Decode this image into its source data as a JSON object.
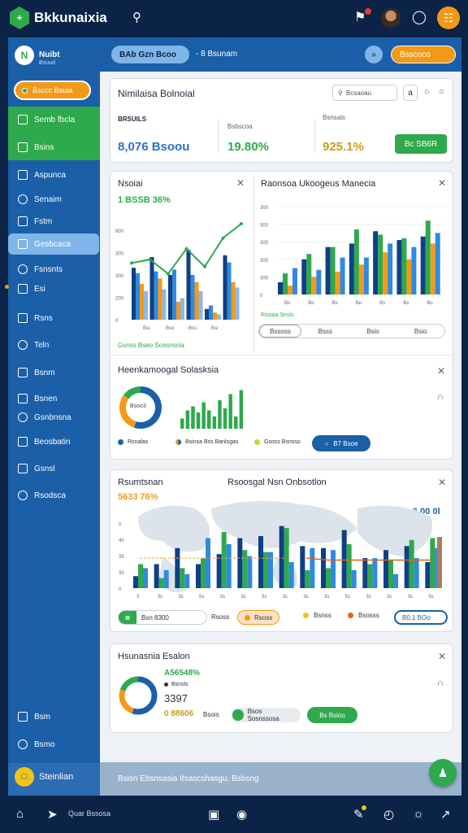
{
  "colors": {
    "green": "#2ea94c",
    "blue": "#1a5fa8",
    "orange": "#f29a18",
    "navy": "#0b2346",
    "lightblue": "#7fb5e8",
    "darkblue": "#0f3f86",
    "accent": "#2f8ae0"
  },
  "header": {
    "app_title": "Bkkunaixia",
    "icons": [
      "hexagon-logo-icon",
      "search-icon",
      "notification-bell-icon",
      "user-avatar",
      "chat-bubble-icon",
      "orange-action-icon"
    ]
  },
  "sidebar": {
    "user_name": "Nuibt",
    "user_role": "Bsuud",
    "cta": "Bsccc Bauia",
    "green_items": [
      "Semb fbcla",
      "Bsins"
    ],
    "items": [
      "Aspunca",
      "Senaim",
      "Fstm",
      "Gesbcaca",
      "Fsnsnts",
      "Esi",
      "Rsns",
      "Teln",
      "Bsnm",
      "Bsnen",
      "Gsnbnsna",
      "Beosbatin",
      "Gsnsl",
      "Rsodsca"
    ],
    "bottom_items": [
      "Bsm",
      "Bsmo"
    ],
    "footer": "Steinlian"
  },
  "main_header": {
    "breadcrumb": "BAb Gzn Bcoo",
    "sub": "- 8 Bsunam",
    "action_label": "Bsscoco"
  },
  "summary": {
    "title": "Nimilaisa Bolnoial",
    "search_placeholder": "Bcsaoau",
    "stats": [
      {
        "label": "BRSUILS",
        "value": "8,076 Bsoou",
        "color": "#2f6fd0"
      },
      {
        "label": "Bsbscoa",
        "value": "19.80%",
        "color": "#2ea94c"
      },
      {
        "label": "Bsnsals",
        "value": "925.1%",
        "color": "#c9a015"
      }
    ],
    "button": "Bc SB6R"
  },
  "card2": {
    "left_title": "Nsoiai",
    "left_metric": "1 BSSB 36%",
    "left_footer": "Gsnss Bseo Scesnscia",
    "left_chart_data": {
      "type": "bar",
      "categories": [
        "Bsi",
        "Bso",
        "Bss",
        "Bsi"
      ],
      "ylabels": [
        "800",
        "300",
        "300",
        "200",
        "0"
      ],
      "series": [
        {
          "name": "",
          "values": [
            58,
            70,
            50,
            78,
            12,
            72
          ]
        },
        {
          "name": "",
          "values": [
            52,
            54,
            56,
            50,
            16,
            64
          ]
        },
        {
          "name": "",
          "values": [
            40,
            46,
            20,
            42,
            8,
            42
          ]
        },
        {
          "name": "",
          "values": [
            32,
            34,
            24,
            32,
            6,
            36
          ]
        }
      ],
      "line": [
        56,
        60,
        44,
        72,
        52,
        84,
        100
      ]
    },
    "right_title": "Raonsoa Ukoogeus Manecia",
    "right_footer": "Rssiaa Snsls",
    "right_chart_data": {
      "type": "bar",
      "categories": [
        "Bo",
        "Bo",
        "Bo",
        "Bu",
        "Bs",
        "Bs",
        "Bs"
      ],
      "ylabels": [
        "300",
        "300",
        "300",
        "300",
        "300",
        "0"
      ],
      "series": [
        {
          "name": "",
          "values": [
            14,
            40,
            54,
            58,
            72,
            62,
            66
          ]
        },
        {
          "name": "",
          "values": [
            24,
            46,
            54,
            74,
            68,
            64,
            84
          ]
        },
        {
          "name": "",
          "values": [
            10,
            20,
            26,
            34,
            48,
            40,
            58
          ]
        },
        {
          "name": "",
          "values": [
            30,
            28,
            42,
            42,
            58,
            54,
            70
          ]
        }
      ]
    },
    "tabs": [
      "Bssoss",
      "Bsss",
      "Bsio",
      "Bsio"
    ]
  },
  "card3": {
    "title": "Heenkamoogal Solasksia",
    "donut_label": "Bsoo3",
    "donut_chart_data": {
      "type": "pie",
      "values": [
        0.55,
        0.3,
        0.15
      ]
    },
    "mini_bar_chart_data": {
      "type": "bar",
      "values": [
        10,
        18,
        22,
        16,
        26,
        18,
        12,
        28,
        20,
        34,
        12,
        38
      ]
    },
    "legend": [
      "Rsnalas",
      "Bsinsa Bss Banlsgas",
      "Gsoss Bsnsso"
    ],
    "button": "B7 Bsoe"
  },
  "card4": {
    "left_title": "Rsumtsnan",
    "left_metric": "5633 76%",
    "right_title": "Rsoosgal Nsn Onbsotlon",
    "right_metric": "6.00 0l",
    "chart_data": {
      "type": "bar",
      "categories": [
        "3",
        "3s",
        "3s",
        "5s",
        "3s",
        "3s",
        "3s",
        "3s",
        "3s",
        "3s",
        "5s",
        "3s",
        "3s",
        "3s",
        "5s"
      ],
      "ylabels": [
        "0",
        "40",
        "35",
        "30",
        "0"
      ],
      "series": [
        {
          "name": "",
          "values": [
            12,
            24,
            40,
            24,
            34,
            50,
            52,
            62,
            42,
            40,
            58,
            30,
            38,
            42,
            26
          ]
        },
        {
          "name": "",
          "values": [
            24,
            10,
            20,
            30,
            56,
            38,
            36,
            60,
            18,
            20,
            44,
            24,
            28,
            48,
            50
          ]
        },
        {
          "name": "",
          "values": [
            20,
            18,
            14,
            50,
            44,
            32,
            36,
            26,
            40,
            38,
            18,
            30,
            14,
            30,
            40
          ]
        }
      ],
      "line": [
        30,
        30,
        30,
        30,
        30,
        30,
        30,
        30,
        30,
        28,
        28,
        28,
        28,
        28,
        28
      ]
    },
    "controls": [
      "Bsn 8300",
      "Rsoss",
      "Bsnss",
      "Bsosss",
      "B0.1 BOo"
    ]
  },
  "card5": {
    "title": "Hsunasnia Esalon",
    "metric1": "A56548%",
    "label1": "Bsnsls",
    "value": "3397",
    "metric2": "0 88606",
    "metric2_suffix": "Bsois",
    "pill": "Bsos Sosnssosa",
    "button": "Bs Bsioo",
    "donut_chart_data": {
      "type": "pie",
      "values": [
        0.55,
        0.25,
        0.2
      ]
    }
  },
  "status": {
    "text": "Bsisn Ebsnsasia Itsascshasgu, Bsbsng"
  },
  "bottom": {
    "app": "Quar Bssosa"
  }
}
